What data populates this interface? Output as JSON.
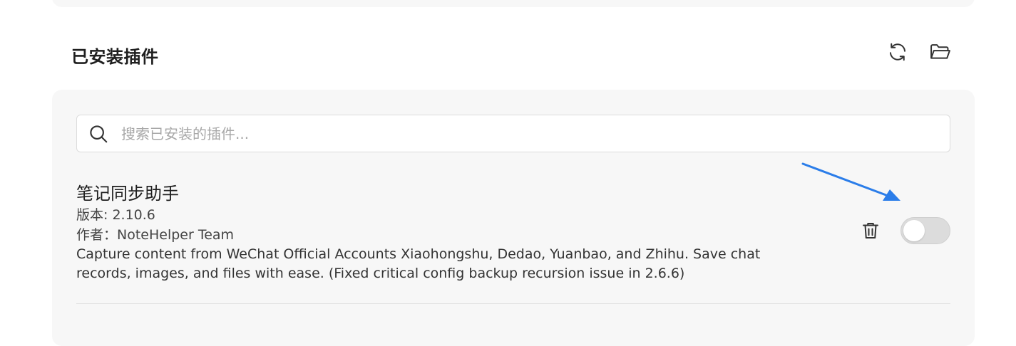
{
  "section": {
    "title": "已安装插件",
    "refresh_icon": "refresh-icon",
    "folder_icon": "folder-open-icon"
  },
  "search": {
    "placeholder": "搜索已安装的插件...",
    "value": "",
    "icon": "search-icon"
  },
  "plugins": [
    {
      "name": "笔记同步助手",
      "version_line": "版本: 2.10.6",
      "author_line": "作者：NoteHelper Team",
      "description": "Capture content from WeChat Official Accounts Xiaohongshu, Dedao, Yuanbao, and Zhihu. Save chat records, images, and files with ease. (Fixed critical config backup recursion issue in 2.6.6)",
      "enabled": false,
      "delete_icon": "trash-icon"
    }
  ],
  "colors": {
    "card_bg": "#f7f7f7",
    "toggle_off": "#dcdcdc",
    "annotation_arrow": "#2b7de9",
    "text_primary": "#1f1f1f"
  }
}
